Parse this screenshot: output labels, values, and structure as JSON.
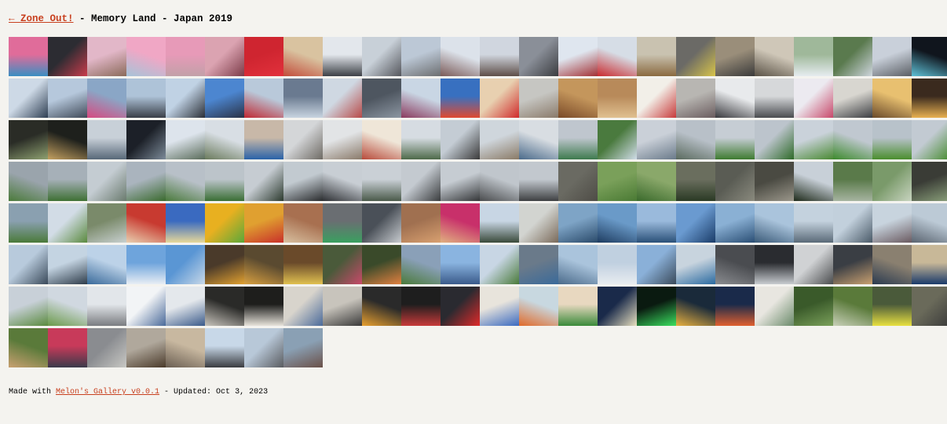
{
  "header": {
    "back_link": "← Zone Out!",
    "title": " - Memory Land - Japan 2019"
  },
  "gallery": {
    "rows": [
      [
        [
          "#e06c9a",
          "#3a8ec2"
        ],
        [
          "#2c2c32",
          "#c93c4c"
        ],
        [
          "#e2b7c8",
          "#8a6a5a"
        ],
        [
          "#f0a7c5",
          "#a6c3d8"
        ],
        [
          "#e79ab8",
          "#c2a0a8"
        ],
        [
          "#dba3b1",
          "#7b3b48"
        ],
        [
          "#cf2530",
          "#e2313c"
        ],
        [
          "#d9c3a0",
          "#c24c3a"
        ],
        [
          "#e3e7ec",
          "#3d4046"
        ],
        [
          "#c8d0d8",
          "#54565c"
        ],
        [
          "#bcc8d6",
          "#6c6e70"
        ],
        [
          "#dce2ea",
          "#7a5a58"
        ],
        [
          "#d0d6df",
          "#5e4e48"
        ],
        [
          "#8a8f98",
          "#3a3c40"
        ],
        [
          "#dfe6ef",
          "#a23034"
        ],
        [
          "#d6dde6",
          "#c92a2e"
        ],
        [
          "#c9c2b0",
          "#8a6a40"
        ],
        [
          "#6b6a66",
          "#d8c44a"
        ],
        [
          "#9a8e7a",
          "#3a3a3a"
        ],
        [
          "#cfc7b8",
          "#5a5246"
        ],
        [
          "#9fb89a",
          "#e6ecf0"
        ],
        [
          "#5a7a4e",
          "#cfd6de"
        ],
        [
          "#c9d0da",
          "#5a5e64"
        ],
        [
          "#10151d",
          "#5ec0d6"
        ],
        [
          "#5aa2e0",
          "#2a4e8c"
        ]
      ],
      [
        [
          "#cdd9e6",
          "#2e3e52"
        ],
        [
          "#b6c8dc",
          "#404a58"
        ],
        [
          "#8aa6c6",
          "#d64a80"
        ],
        [
          "#aec3d8",
          "#3a3f48"
        ],
        [
          "#c0d2e4",
          "#2a2e36"
        ],
        [
          "#4c86d0",
          "#2a3246"
        ],
        [
          "#b9c9da",
          "#c02832"
        ],
        [
          "#6a7a90",
          "#c8d4e0"
        ],
        [
          "#cfd8e2",
          "#b84a48"
        ],
        [
          "#4e5660",
          "#8c96a2"
        ],
        [
          "#c9d6e4",
          "#8a3a5e"
        ],
        [
          "#3870c0",
          "#e04a30"
        ],
        [
          "#e8d0b0",
          "#d02a2a"
        ],
        [
          "#c6c6c2",
          "#8a7a6a"
        ],
        [
          "#c4965c",
          "#7a4a28"
        ],
        [
          "#b88a5a",
          "#e0c090"
        ],
        [
          "#f2efe8",
          "#c83a3a"
        ],
        [
          "#b8b6b2",
          "#6a5c5e"
        ],
        [
          "#e8eaec",
          "#3a3a3e"
        ],
        [
          "#d6d8da",
          "#4a4c50"
        ],
        [
          "#eceaf0",
          "#c8486a"
        ],
        [
          "#d8d6d0",
          "#3c3e42"
        ],
        [
          "#e8c070",
          "#6a4a2a"
        ],
        [
          "#3a2a1e",
          "#e8b050"
        ],
        [
          "#1a1c1a",
          "#6a7a5a"
        ]
      ],
      [
        [
          "#2a2c26",
          "#8ea070"
        ],
        [
          "#1e201c",
          "#c4a060"
        ],
        [
          "#c8d0d8",
          "#586878"
        ],
        [
          "#1c2028",
          "#7c8a98"
        ],
        [
          "#dde4ec",
          "#5a6c5a"
        ],
        [
          "#d8dee4",
          "#6a7a5c"
        ],
        [
          "#c8b8a8",
          "#2a62a8"
        ],
        [
          "#d4d6d8",
          "#6e6a64"
        ],
        [
          "#e2e4e6",
          "#8a7a6a"
        ],
        [
          "#efe6d8",
          "#b84a3a"
        ],
        [
          "#d6dce2",
          "#4e6a4a"
        ],
        [
          "#c4ccd4",
          "#3a3a3a"
        ],
        [
          "#cfd6dc",
          "#8a7a66"
        ],
        [
          "#d8dde2",
          "#4a6a8a"
        ],
        [
          "#bfc6ce",
          "#3e7a4e"
        ],
        [
          "#4a7a3e",
          "#d0dce8"
        ],
        [
          "#cad0d8",
          "#6a7a8a"
        ],
        [
          "#b8c0c8",
          "#5a6a5e"
        ],
        [
          "#c6cdd4",
          "#3e7a30"
        ],
        [
          "#bcc4cc",
          "#2e6a28"
        ],
        [
          "#cad2da",
          "#4a8a34"
        ],
        [
          "#c0c8d0",
          "#3c8a2c"
        ],
        [
          "#b8c2ca",
          "#4a8e2e"
        ],
        [
          "#c2cad2",
          "#448a2c"
        ],
        [
          "#b4bec8",
          "#3e8a2a"
        ]
      ],
      [
        [
          "#9aa4ac",
          "#4a7a3a"
        ],
        [
          "#a6b0b8",
          "#3e7034"
        ],
        [
          "#c4ccd2",
          "#6a7a6e"
        ],
        [
          "#aab4be",
          "#3a6a2e"
        ],
        [
          "#b8c0c8",
          "#4a7a3c"
        ],
        [
          "#bcc4ca",
          "#3a6e34"
        ],
        [
          "#c6ccd2",
          "#2c3a2e"
        ],
        [
          "#c2cad0",
          "#2a2c2e"
        ],
        [
          "#c8ced4",
          "#2e3034"
        ],
        [
          "#cad0d6",
          "#4a5a4a"
        ],
        [
          "#c4cad0",
          "#3a3c3e"
        ],
        [
          "#c6ccd2",
          "#343638"
        ],
        [
          "#c0c6cc",
          "#4a4c4e"
        ],
        [
          "#c2c8ce",
          "#3e4042"
        ],
        [
          "#6a6a62",
          "#4e4c46"
        ],
        [
          "#7aa05a",
          "#4a7a34"
        ],
        [
          "#8aa86a",
          "#3a6a2c"
        ],
        [
          "#6a6e5e",
          "#2a3a24"
        ],
        [
          "#5a5c54",
          "#8a8a7e"
        ],
        [
          "#4a4a42",
          "#9a968a"
        ],
        [
          "#c8d0d8",
          "#1e2a1a"
        ],
        [
          "#5a7a4a",
          "#a6b4a0"
        ],
        [
          "#7a9a6a",
          "#c8d4c0"
        ],
        [
          "#3a3c36",
          "#8aa07a"
        ],
        [
          "#4a4c46",
          "#6a8a5a"
        ]
      ],
      [
        [
          "#8aa0b0",
          "#4a7a3a"
        ],
        [
          "#d2dce6",
          "#5a8a3e"
        ],
        [
          "#7a8a6a",
          "#c8d0d0"
        ],
        [
          "#c83a30",
          "#e8d0b0"
        ],
        [
          "#3a6ac0",
          "#e6d89a"
        ],
        [
          "#e8b020",
          "#5aa83a"
        ],
        [
          "#e0a030",
          "#c8302a"
        ],
        [
          "#a87050",
          "#d8c0a0"
        ],
        [
          "#6a6e72",
          "#3aa060"
        ],
        [
          "#4a5058",
          "#c8ccd0"
        ],
        [
          "#a07050",
          "#d8a070"
        ],
        [
          "#c8306a",
          "#e0b080"
        ],
        [
          "#c8d6e4",
          "#3a4a3a"
        ],
        [
          "#d2d4d0",
          "#7a6a5a"
        ],
        [
          "#7ea4c6",
          "#2a4a6a"
        ],
        [
          "#6a9ac8",
          "#1e3c60"
        ],
        [
          "#9abadc",
          "#2a5078"
        ],
        [
          "#6a9ad0",
          "#1a3c68"
        ],
        [
          "#8ab0d4",
          "#2a4e74"
        ],
        [
          "#aac4dc",
          "#3a5a78"
        ],
        [
          "#c4d2de",
          "#5a6a78"
        ],
        [
          "#c2d0dc",
          "#4a5a68"
        ],
        [
          "#c8d4de",
          "#6a5a60"
        ],
        [
          "#bccad6",
          "#5a6470"
        ],
        [
          "#b4c4d2",
          "#4e5a66"
        ]
      ],
      [
        [
          "#b8cadc",
          "#3a4a5a"
        ],
        [
          "#c4d4e2",
          "#2e3c4a"
        ],
        [
          "#bcd2e8",
          "#3a6a9a"
        ],
        [
          "#6ea4dc",
          "#e8eef4"
        ],
        [
          "#5a96d4",
          "#c8d8e8"
        ],
        [
          "#4a3a2a",
          "#e0a030"
        ],
        [
          "#5a4a30",
          "#d8a040"
        ],
        [
          "#6a4a2a",
          "#e0c050"
        ],
        [
          "#4a5a3a",
          "#c84a6a"
        ],
        [
          "#3a4a2a",
          "#e08040"
        ],
        [
          "#8aa0b8",
          "#4a7a3a"
        ],
        [
          "#8ab4e0",
          "#3a5a8a"
        ],
        [
          "#c8d6e4",
          "#4a7a3a"
        ],
        [
          "#6a7a8a",
          "#3a6a9a"
        ],
        [
          "#aac4dc",
          "#4a6a8a"
        ],
        [
          "#c0d0e0",
          "#e8ecf0"
        ],
        [
          "#8ab0d8",
          "#3a4a5a"
        ],
        [
          "#c8d4de",
          "#2a6aa0"
        ],
        [
          "#4a4c50",
          "#8a8c90"
        ],
        [
          "#2a2c30",
          "#c8ccd0"
        ],
        [
          "#d0d2d4",
          "#4a4c4e"
        ],
        [
          "#3a3e44",
          "#c8a070"
        ],
        [
          "#8a8070",
          "#2a3a50"
        ],
        [
          "#c8b898",
          "#1a3a6a"
        ],
        [
          "#d8c8a8",
          "#2a4a7a"
        ]
      ],
      [
        [
          "#c8d0d8",
          "#5a8a3e"
        ],
        [
          "#d0d8e0",
          "#6a9a4a"
        ],
        [
          "#e2e6ea",
          "#7a7c80"
        ],
        [
          "#f2f4f6",
          "#4a6a9a"
        ],
        [
          "#e4e8ec",
          "#3a5a8a"
        ],
        [
          "#2a2a28",
          "#c8c4bc"
        ],
        [
          "#1e1e1c",
          "#e8e4dc"
        ],
        [
          "#d8d4cc",
          "#4a6a9a"
        ],
        [
          "#c8c4bc",
          "#3a3a3a"
        ],
        [
          "#2a2a2a",
          "#e8a030"
        ],
        [
          "#1e1e1e",
          "#c83a3a"
        ],
        [
          "#2a2a30",
          "#e02a2a"
        ],
        [
          "#e8e4dc",
          "#3a6ac0"
        ],
        [
          "#c8d8e0",
          "#e06a2a"
        ],
        [
          "#e8d8c0",
          "#3a8a3a"
        ],
        [
          "#1a2a4a",
          "#e8e0c0"
        ],
        [
          "#0a1a10",
          "#3ae060"
        ],
        [
          "#1a2a3a",
          "#e8b040"
        ],
        [
          "#1a2a4a",
          "#e06030"
        ],
        [
          "#e8e6e0",
          "#6a8a6a"
        ],
        [
          "#3a5a2a",
          "#7aa05a"
        ],
        [
          "#5a7a3a",
          "#c8d0b8"
        ],
        [
          "#4a5a3a",
          "#e8e040"
        ],
        [
          "#6a6a5a",
          "#3a3a3a"
        ],
        [
          "#4a6a3a",
          "#9abc7a"
        ]
      ],
      [
        [
          "#5a7a3a",
          "#c8a070"
        ],
        [
          "#c83a5a",
          "#3a3a4a"
        ],
        [
          "#8a8c90",
          "#c8c8c4"
        ],
        [
          "#b0a89c",
          "#4a3a2a"
        ],
        [
          "#c8b8a0",
          "#6a5e52"
        ],
        [
          "#c8d8e8",
          "#3a3c40"
        ],
        [
          "#b8c8d8",
          "#5a5c60"
        ],
        [
          "#8aa0b4",
          "#6a5048"
        ]
      ]
    ]
  },
  "footer": {
    "made_with": "Made with ",
    "link": "Melon's Gallery v0.0.1",
    "updated": " - Updated: Oct 3, 2023"
  }
}
